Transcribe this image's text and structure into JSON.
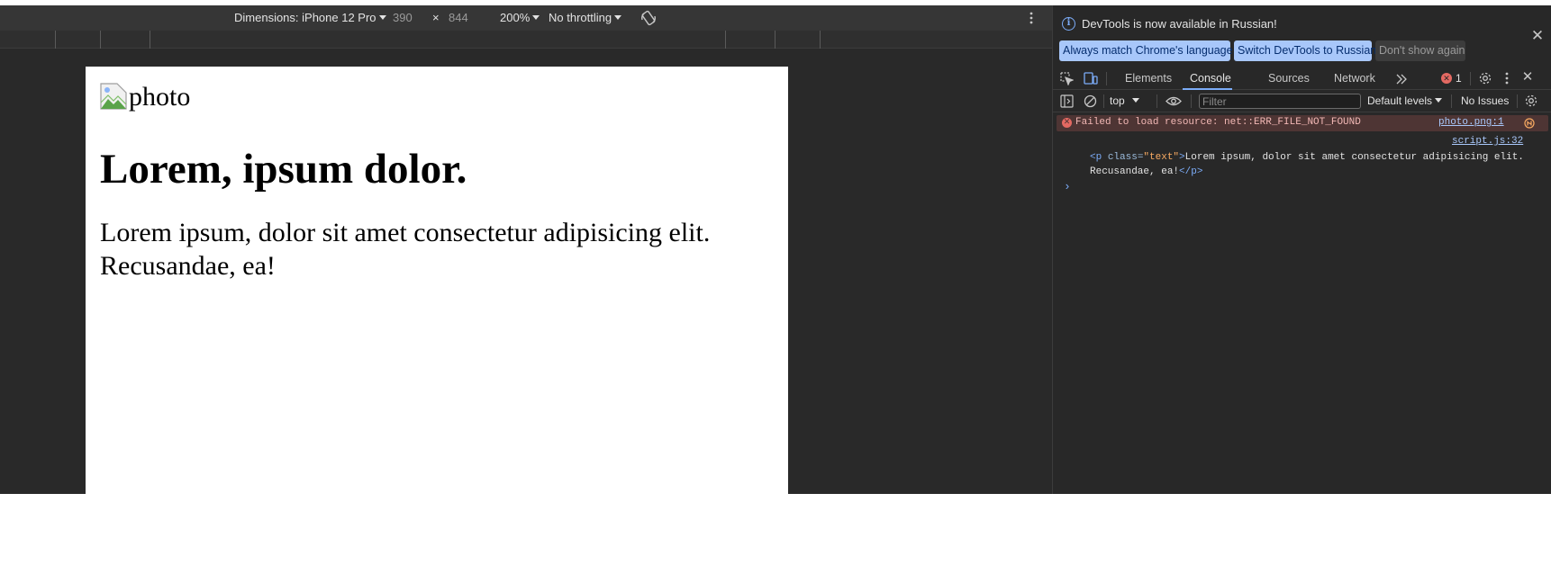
{
  "device_toolbar": {
    "dimensions_label": "Dimensions: iPhone 12 Pro",
    "width": "390",
    "times": "×",
    "height": "844",
    "zoom": "200%",
    "throttling": "No throttling"
  },
  "viewport": {
    "image_alt": "photo",
    "heading": "Lorem, ipsum dolor.",
    "text": "Lorem ipsum, dolor sit amet consectetur adipisicing elit. Recusandae, ea!"
  },
  "devtools": {
    "info_bar": {
      "message": "DevTools is now available in Russian!",
      "btn_match": "Always match Chrome's language",
      "btn_switch": "Switch DevTools to Russian",
      "btn_dismiss": "Don't show again"
    },
    "tabs": [
      "Elements",
      "Console",
      "Sources",
      "Network"
    ],
    "error_count": "1",
    "console_toolbar": {
      "context": "top",
      "filter_placeholder": "Filter",
      "levels": "Default levels",
      "issues": "No Issues"
    },
    "console": {
      "error_message": "Failed to load resource: net::ERR_FILE_NOT_FOUND",
      "error_source": "photo.png:1",
      "log_source": "script.js:32",
      "log_open_tag": "<p",
      "log_attr_name": "class=",
      "log_attr_value": "\"text\"",
      "log_gt": ">",
      "log_text_line1": "Lorem ipsum, dolor sit amet consectetur adipisicing elit.",
      "log_text_line2": "Recusandae, ea!",
      "log_close_tag": "</p>",
      "prompt": "›"
    }
  },
  "colors": {
    "accent_blue": "#a8c7fa",
    "error_red": "#e46962",
    "panel_bg": "#282828"
  }
}
